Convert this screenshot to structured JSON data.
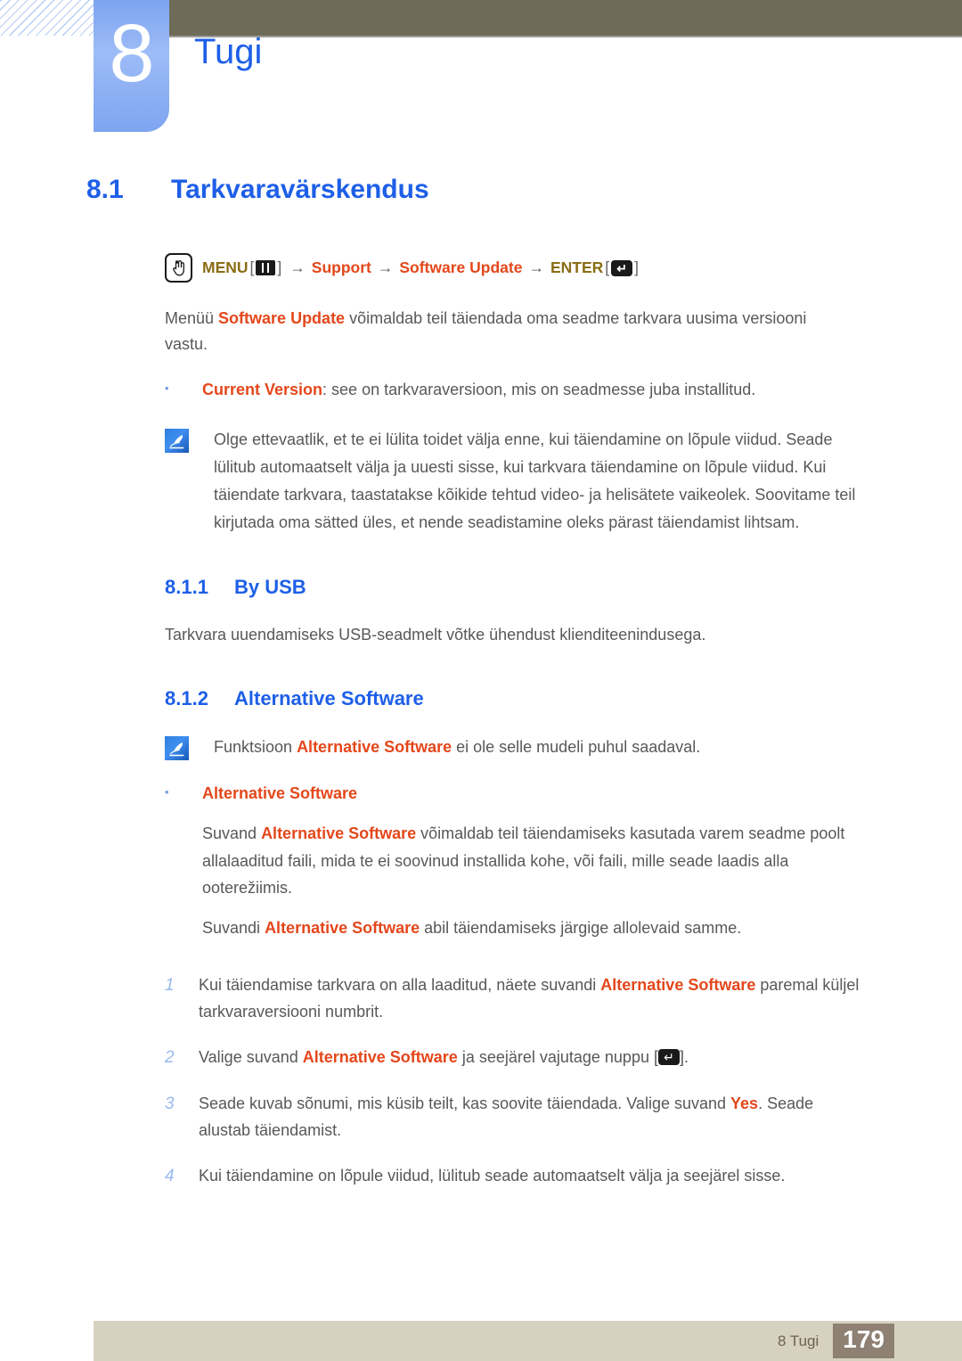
{
  "header": {
    "chapter_number": "8",
    "chapter_title": "Tugi",
    "accent_blue": "#1e5fe8",
    "tab_blue": "#7ea5f1",
    "bar_olive": "#6e6c58"
  },
  "section": {
    "number": "8.1",
    "title": "Tarkvaravärskendus"
  },
  "navpath": {
    "hand_icon": "hand-press-icon",
    "menu_label": "MENU",
    "menu_icon": "menu-bars-icon",
    "bracket_open": "[",
    "bracket_close": "]",
    "arrow": "→",
    "step_support": "Support",
    "step_software_update": "Software Update",
    "enter_label": "ENTER",
    "enter_icon": "enter-key-icon",
    "enter_glyph": "↵",
    "color_menu": "#8a6d15",
    "color_step": "#e4471b"
  },
  "intro": {
    "before": "Menüü ",
    "keyword": "Software Update",
    "after": " võimaldab teil täiendada oma seadme tarkvara uusima versiooni vastu."
  },
  "bullet_current_version": {
    "marker": "•",
    "keyword": "Current Version",
    "text": ": see on tarkvaraversioon, mis on seadmesse juba installitud."
  },
  "note_main": {
    "icon": "note-pencil-icon",
    "text": "Olge ettevaatlik, et te ei lülita toidet välja enne, kui täiendamine on lõpule viidud. Seade lülitub automaatselt välja ja uuesti sisse, kui tarkvara täiendamine on lõpule viidud. Kui täiendate tarkvara, taastatakse kõikide tehtud video- ja helisätete vaikeolek. Soovitame teil kirjutada oma sätted üles, et nende seadistamine oleks pärast täiendamist lihtsam."
  },
  "subsection_usb": {
    "number": "8.1.1",
    "title": "By USB",
    "paragraph": "Tarkvara uuendamiseks USB-seadmelt võtke ühendust klienditeenindusega."
  },
  "subsection_alt": {
    "number": "8.1.2",
    "title": "Alternative Software",
    "note": {
      "icon": "note-pencil-icon",
      "before": "Funktsioon ",
      "keyword": "Alternative Software",
      "after": " ei ole selle mudeli puhul saadaval."
    },
    "bullet": {
      "marker": "•",
      "keyword": "Alternative Software"
    },
    "paragraph1": {
      "before": "Suvand ",
      "keyword": "Alternative Software",
      "after": " võimaldab teil täiendamiseks kasutada varem seadme poolt allalaaditud faili, mida te ei soovinud installida kohe, või faili, mille seade laadis alla ooterežiimis."
    },
    "paragraph2": {
      "before": "Suvandi ",
      "keyword": "Alternative Software",
      "after": " abil täiendamiseks järgige allolevaid samme."
    },
    "steps": [
      {
        "number": "1",
        "before": "Kui täiendamise tarkvara on alla laaditud, näete suvandi ",
        "keyword": "Alternative Software",
        "after": " paremal küljel tarkvaraversiooni numbrit."
      },
      {
        "number": "2",
        "before": "Valige suvand ",
        "keyword": "Alternative Software",
        "after": " ja seejärel vajutage nuppu [",
        "icon": "enter-key-icon",
        "tail": "]."
      },
      {
        "number": "3",
        "before": "Seade kuvab sõnumi, mis küsib teilt, kas soovite täiendada. Valige suvand ",
        "keyword": "Yes",
        "after": ". Seade alustab täiendamist."
      },
      {
        "number": "4",
        "before": "Kui täiendamine on lõpule viidud, lülitub seade automaatselt välja ja seejärel sisse.",
        "keyword": "",
        "after": ""
      }
    ]
  },
  "footer": {
    "label": "8 Tugi",
    "page_number": "179",
    "bar_color": "#d7d2bf",
    "page_box_color": "#8e8073"
  }
}
